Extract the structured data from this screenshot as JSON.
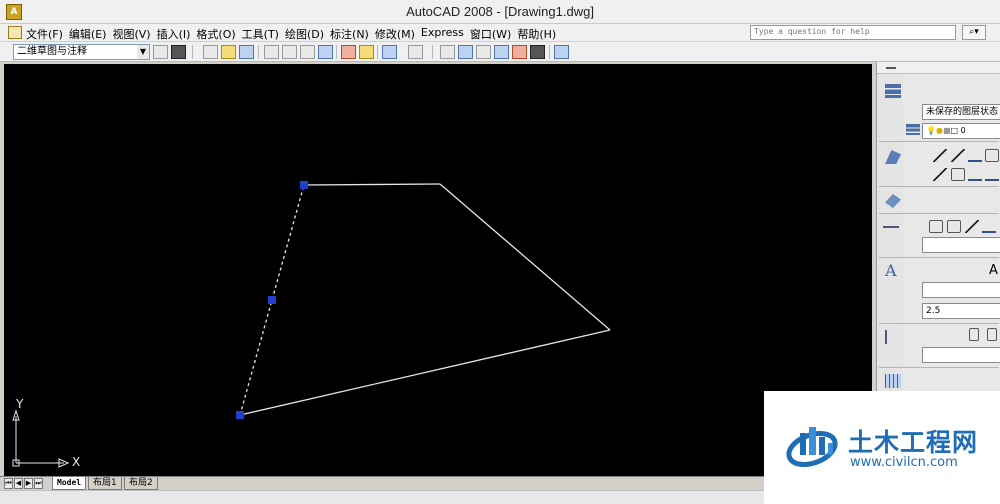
{
  "window": {
    "title": "AutoCAD 2008 - [Drawing1.dwg]"
  },
  "menu": {
    "items": [
      "文件(F)",
      "编辑(E)",
      "视图(V)",
      "插入(I)",
      "格式(O)",
      "工具(T)",
      "绘图(D)",
      "标注(N)",
      "修改(M)",
      "Express",
      "窗口(W)",
      "帮助(H)"
    ]
  },
  "help_search": {
    "placeholder": "Type a question for help"
  },
  "toolbar": {
    "workspace": "二维草图与注释"
  },
  "canvas": {
    "background": "#000000",
    "line_color": "#e6e6e6",
    "grip_color": "#1e3fd0",
    "ucs": {
      "y_label": "Y",
      "x_label": "X"
    }
  },
  "layout_tabs": {
    "items": [
      "Model",
      "布局1",
      "布局2"
    ],
    "active": "Model"
  },
  "palette": {
    "layer_state": "未保存的图层状态",
    "layer_value": "0",
    "text_style_glyph": "A",
    "text_height": "2.5"
  },
  "watermark": {
    "name": "土木工程网",
    "url": "www.civilcn.com",
    "color": "#1f6db5"
  }
}
